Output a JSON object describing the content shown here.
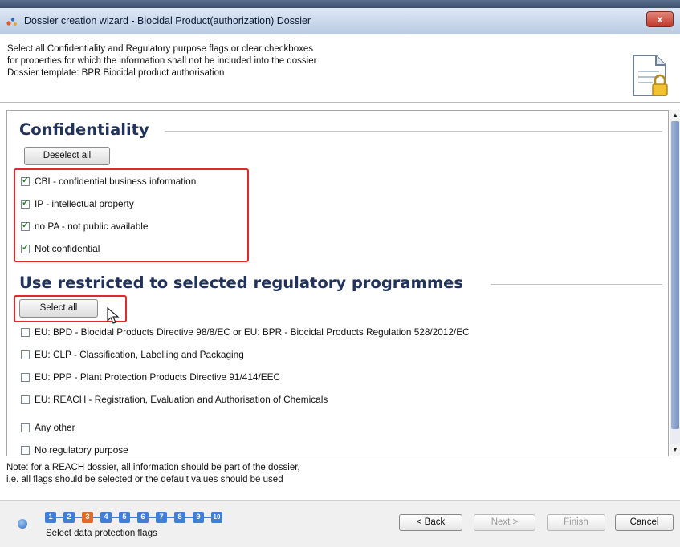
{
  "window": {
    "title": "Dossier creation wizard - Biocidal Product(authorization) Dossier",
    "close_label": "x"
  },
  "header": {
    "line1": "Select all Confidentiality and Regulatory purpose flags or clear checkboxes",
    "line2": "for properties for which the information shall not be included into the dossier",
    "line3": "Dossier template: BPR Biocidal product authorisation"
  },
  "confidentiality": {
    "title": "Confidentiality",
    "deselect_label": "Deselect all",
    "items": [
      {
        "label": "CBI - confidential business information",
        "checked": true
      },
      {
        "label": "IP - intellectual property",
        "checked": true
      },
      {
        "label": "no PA - not public available",
        "checked": true
      },
      {
        "label": "Not confidential",
        "checked": true
      }
    ]
  },
  "regulatory": {
    "title": "Use restricted to selected regulatory programmes",
    "select_all_label": "Select all",
    "items": [
      {
        "label": "EU: BPD - Biocidal Products Directive 98/8/EC or EU: BPR - Biocidal Products Regulation 528/2012/EC",
        "checked": false
      },
      {
        "label": "EU: CLP - Classification, Labelling and Packaging",
        "checked": false
      },
      {
        "label": "EU: PPP - Plant Protection Products Directive 91/414/EEC",
        "checked": false
      },
      {
        "label": "EU: REACH - Registration, Evaluation and Authorisation of Chemicals",
        "checked": false
      },
      {
        "label": "Any other",
        "checked": false
      },
      {
        "label": "No regulatory purpose",
        "checked": false
      }
    ]
  },
  "note": {
    "line1": "Note: for a REACH dossier, all information should be part of the dossier,",
    "line2": "i.e. all flags should be selected or the default values should be used"
  },
  "footer": {
    "steps": [
      "1",
      "2",
      "3",
      "4",
      "5",
      "6",
      "7",
      "8",
      "9",
      "10"
    ],
    "active_step": 3,
    "step_label": "Select data protection flags",
    "back_label": "< Back",
    "next_label": "Next >",
    "finish_label": "Finish",
    "cancel_label": "Cancel"
  },
  "colors": {
    "section_title": "#22335b",
    "highlight": "#e0282e",
    "step": "#3f7fd9",
    "active_step": "#e06a2a"
  }
}
